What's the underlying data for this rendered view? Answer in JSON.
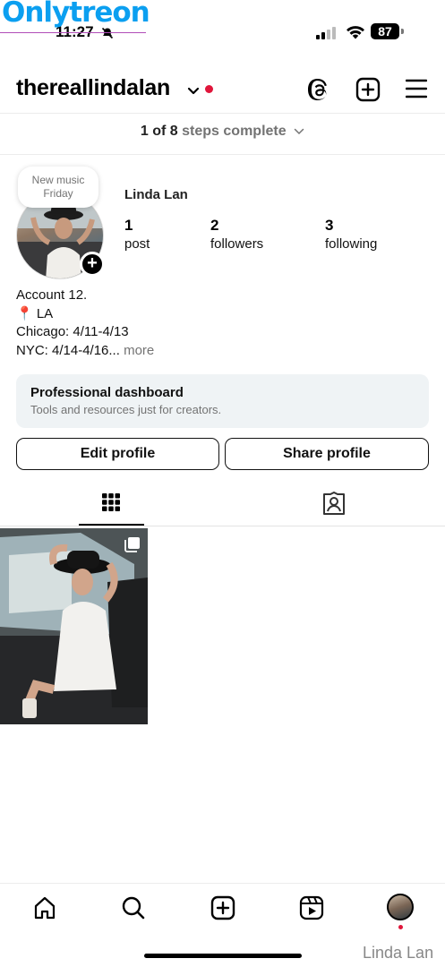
{
  "watermark": {
    "text": "Onlytreon"
  },
  "status_bar": {
    "time": "11:27",
    "battery": "87"
  },
  "header": {
    "username": "thereallindalan"
  },
  "steps": {
    "count": "1 of 8",
    "text": "steps complete"
  },
  "profile": {
    "note": {
      "line1": "New music",
      "line2": "Friday"
    },
    "display_name": "Linda Lan",
    "stats": [
      {
        "value": "1",
        "label": "post"
      },
      {
        "value": "2",
        "label": "followers"
      },
      {
        "value": "3",
        "label": "following"
      }
    ],
    "bio": [
      "Account 12.",
      "📍 LA",
      "Chicago: 4/11-4/13",
      "NYC: 4/14-4/16..."
    ],
    "bio_more": "more"
  },
  "dashboard": {
    "title": "Professional dashboard",
    "subtitle": "Tools and resources just for creators."
  },
  "buttons": {
    "edit": "Edit profile",
    "share": "Share profile"
  },
  "tabs": [
    {
      "icon": "grid-icon",
      "active": true
    },
    {
      "icon": "tagged-icon",
      "active": false
    }
  ],
  "bottom_nav": [
    "home-icon",
    "search-icon",
    "create-icon",
    "reels-icon",
    "profile-avatar"
  ],
  "signature": "Linda Lan",
  "colors": {
    "accent_red": "#e0163b",
    "muted": "#737373",
    "dashboard_bg": "#eff3f5",
    "watermark": "#0b9ff0"
  }
}
